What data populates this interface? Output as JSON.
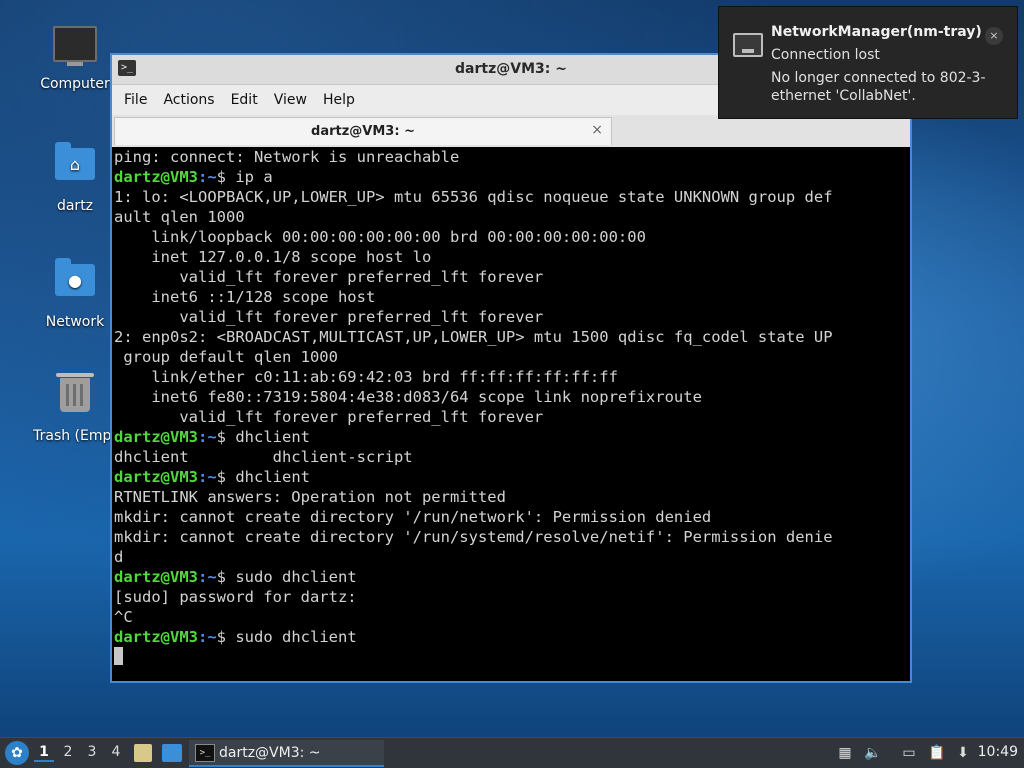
{
  "desktop": {
    "icons": [
      {
        "label": "Computer"
      },
      {
        "label": "dartz"
      },
      {
        "label": "Network"
      },
      {
        "label": "Trash (Empt"
      }
    ]
  },
  "window": {
    "title": "dartz@VM3: ~",
    "menu": [
      "File",
      "Actions",
      "Edit",
      "View",
      "Help"
    ],
    "tab": {
      "label": "dartz@VM3: ~",
      "close": "×"
    }
  },
  "terminal": {
    "lines": [
      {
        "text": "ping: connect: Network is unreachable"
      },
      {
        "prompt": true,
        "user": "dartz@VM3",
        "sep": ":",
        "path": "~",
        "end": "$ ",
        "cmd": "ip a"
      },
      {
        "text": "1: lo: <LOOPBACK,UP,LOWER_UP> mtu 65536 qdisc noqueue state UNKNOWN group def"
      },
      {
        "text": "ault qlen 1000"
      },
      {
        "text": "    link/loopback 00:00:00:00:00:00 brd 00:00:00:00:00:00"
      },
      {
        "text": "    inet 127.0.0.1/8 scope host lo"
      },
      {
        "text": "       valid_lft forever preferred_lft forever"
      },
      {
        "text": "    inet6 ::1/128 scope host"
      },
      {
        "text": "       valid_lft forever preferred_lft forever"
      },
      {
        "text": "2: enp0s2: <BROADCAST,MULTICAST,UP,LOWER_UP> mtu 1500 qdisc fq_codel state UP"
      },
      {
        "text": " group default qlen 1000"
      },
      {
        "text": "    link/ether c0:11:ab:69:42:03 brd ff:ff:ff:ff:ff:ff"
      },
      {
        "text": "    inet6 fe80::7319:5804:4e38:d083/64 scope link noprefixroute"
      },
      {
        "text": "       valid_lft forever preferred_lft forever"
      },
      {
        "prompt": true,
        "user": "dartz@VM3",
        "sep": ":",
        "path": "~",
        "end": "$ ",
        "cmd": "dhclient"
      },
      {
        "text": "dhclient         dhclient-script"
      },
      {
        "prompt": true,
        "user": "dartz@VM3",
        "sep": ":",
        "path": "~",
        "end": "$ ",
        "cmd": "dhclient"
      },
      {
        "text": "RTNETLINK answers: Operation not permitted"
      },
      {
        "text": "mkdir: cannot create directory '/run/network': Permission denied"
      },
      {
        "text": "mkdir: cannot create directory '/run/systemd/resolve/netif': Permission denie"
      },
      {
        "text": "d"
      },
      {
        "prompt": true,
        "user": "dartz@VM3",
        "sep": ":",
        "path": "~",
        "end": "$ ",
        "cmd": "sudo dhclient"
      },
      {
        "text": "[sudo] password for dartz:"
      },
      {
        "text": "^C"
      },
      {
        "prompt": true,
        "user": "dartz@VM3",
        "sep": ":",
        "path": "~",
        "end": "$ ",
        "cmd": "sudo dhclient"
      },
      {
        "cursor": true
      }
    ]
  },
  "notification": {
    "title": "NetworkManager(nm-tray)",
    "subtitle": "Connection lost",
    "body": "No longer connected to 802-3-ethernet 'CollabNet'.",
    "close": "×"
  },
  "taskbar": {
    "workspaces": [
      "1",
      "2",
      "3",
      "4"
    ],
    "task_label": "dartz@VM3: ~",
    "clock": "10:49"
  }
}
